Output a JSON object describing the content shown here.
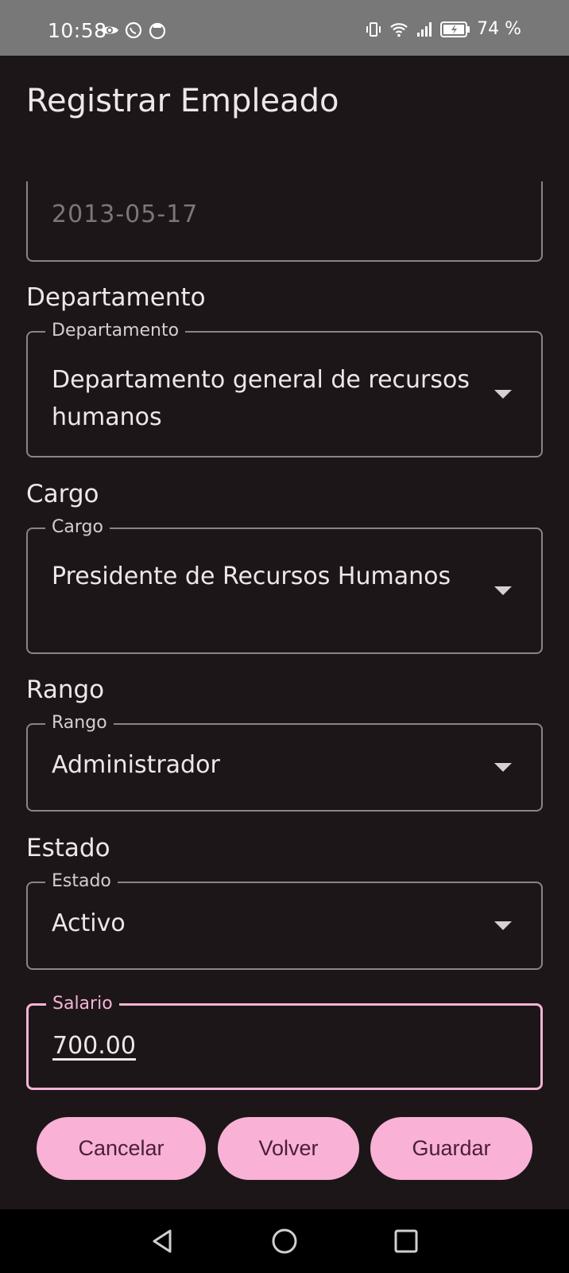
{
  "status_bar": {
    "time": "10:58",
    "battery": "74 %",
    "icons_left": [
      "eye-icon",
      "whatsapp-icon",
      "app-icon"
    ],
    "icons_right": [
      "vibrate-icon",
      "wifi-icon",
      "signal-icon",
      "battery-icon"
    ]
  },
  "app_bar": {
    "title": "Registrar Empleado"
  },
  "form": {
    "fecha": {
      "value": "2013-05-17"
    },
    "departamento": {
      "section_label": "Departamento",
      "legend": "Departamento",
      "value": "Departamento general de recursos humanos"
    },
    "cargo": {
      "section_label": "Cargo",
      "legend": "Cargo",
      "value": "Presidente de Recursos Humanos"
    },
    "rango": {
      "section_label": "Rango",
      "legend": "Rango",
      "value": "Administrador"
    },
    "estado": {
      "section_label": "Estado",
      "legend": "Estado",
      "value": "Activo"
    },
    "salario": {
      "legend": "Salario",
      "value": "700.00"
    }
  },
  "buttons": {
    "cancel": "Cancelar",
    "back": "Volver",
    "save": "Guardar"
  },
  "colors": {
    "background": "#1c1619",
    "accent": "#f9b1d5",
    "status_bar": "#787878"
  }
}
